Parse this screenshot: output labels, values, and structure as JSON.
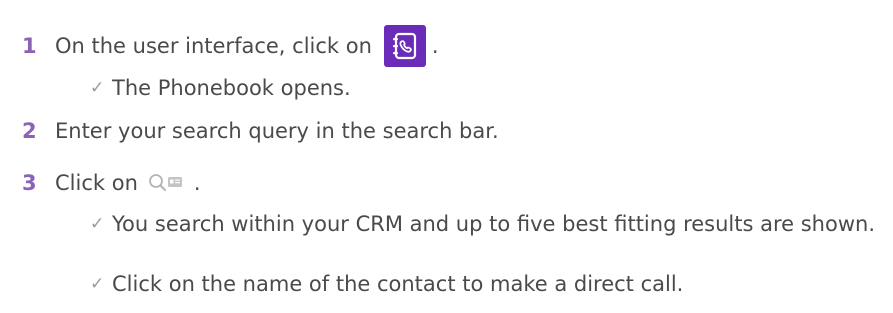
{
  "steps": [
    {
      "number": "1",
      "text": "On the user interface, click on",
      "icon": "phonebook-icon",
      "suffix": ".",
      "results": [
        "The Phonebook opens."
      ]
    },
    {
      "number": "2",
      "text": "Enter your search query in the search bar.",
      "results": []
    },
    {
      "number": "3",
      "text": "Click on",
      "icon": "crm-search-icon",
      "suffix": ".",
      "results": [
        "You search within your CRM and up to five best fitting results are shown.",
        "Click on the name of the contact to make a direct call."
      ]
    }
  ],
  "colors": {
    "step_number": "#8a62b8",
    "phonebook_icon_bg": "#6a2bb8",
    "check": "#9a9a9a",
    "text": "#4a4a4a"
  },
  "check_glyph": "✓"
}
